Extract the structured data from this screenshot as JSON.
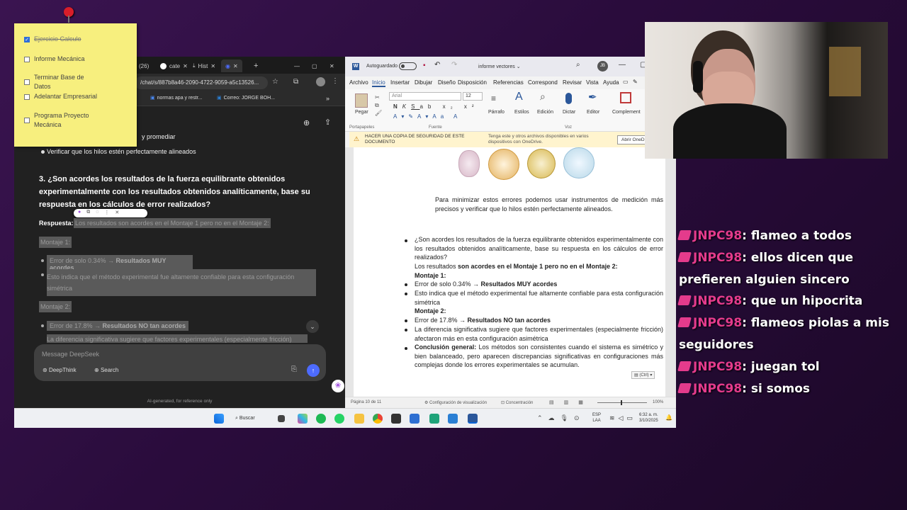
{
  "sticky": {
    "items": [
      {
        "label": "Ejercicio Calculo",
        "checked": true
      },
      {
        "label": "Informe Mecánica",
        "checked": false
      },
      {
        "label": "Terminar Base de Datos",
        "checked": false
      },
      {
        "label": "Adelantar Empresarial",
        "checked": false
      },
      {
        "label": "Programa Proyecto Mecánica",
        "checked": false
      }
    ]
  },
  "chrome": {
    "tabs": [
      {
        "label": "(26)"
      },
      {
        "label": "cate"
      },
      {
        "label": "Hist"
      }
    ],
    "url": "/chat/s/887b8a46-2090-4722-9059-a5c13526...",
    "bookmarks": [
      {
        "label": "normas apa y restr..."
      },
      {
        "label": "Correo: JORGE BOH..."
      }
    ]
  },
  "deepseek": {
    "partial_line": "y promediar",
    "bullet_prev": "Verificar que los hilos estén perfectamente alineados",
    "question": "3. ¿Son acordes los resultados de la fuerza equilibrante obtenidos experimentalmente con los resultados obtenidos analíticamente, base su respuesta en los cálculos de error realizados?",
    "answer_label": "Respuesta:",
    "answer_text": "Los resultados son acordes en el Montaje 1 pero no en el Montaje 2:",
    "montaje1": "Montaje 1:",
    "m1_b1_a": "Error de solo 0.34% → ",
    "m1_b1_b": "Resultados MUY acordes",
    "m1_b2": "Esto indica que el método experimental fue altamente confiable para esta configuración simétrica",
    "montaje2": "Montaje 2:",
    "m2_b1_a": "Error de 17.8% → ",
    "m2_b1_b": "Resultados NO tan acordes",
    "m2_b2": "La diferencia significativa sugiere que factores experimentales (especialmente fricción)",
    "placeholder": "Message DeepSeek",
    "deepthink": "DeepThink",
    "search": "Search",
    "footer": "AI-generated, for reference only"
  },
  "word": {
    "autosave": "Autoguardado",
    "doc_title": "informe vectores",
    "menu": [
      "Archivo",
      "Inicio",
      "Insertar",
      "Dibujar",
      "Diseño",
      "Disposición",
      "Referencias",
      "Correspond",
      "Revisar",
      "Vista",
      "Ayuda"
    ],
    "font": "Arial",
    "size": "12",
    "ribbon_groups": [
      "Pegar",
      "Portapapeles",
      "Fuente",
      "Párrafo",
      "Estilos",
      "Edición",
      "Dictar",
      "Voz",
      "Editor",
      "Complement"
    ],
    "warning_title": "HACER UNA COPIA DE SEGURIDAD DE ESTE DOCUMENTO",
    "warning_text": "Tenga este y otros archivos disponibles en varios dispositivos con OneDrive.",
    "warning_button": "Abrir OneD",
    "p1": "Para minimizar estos errores podemos usar instrumentos de medición más precisos y verificar que lo hilos estén perfectamente alineados.",
    "q": "¿Son acordes los resultados de la fuerza equilibrante obtenidos experimentalmente con los resultados obtenidos analíticamente, base su respuesta en los cálculos de error realizados?",
    "r1a": "Los resultados ",
    "r1b": "son acordes en el Montaje 1 pero no en el Montaje 2:",
    "m1": "Montaje 1:",
    "b1a": "Error de solo 0.34% → ",
    "b1b": "Resultados MUY acordes",
    "b2": "Esto indica que el método experimental fue altamente confiable para esta configuración simétrica",
    "m2": "Montaje 2:",
    "b3a": "Error de 17.8% → ",
    "b3b": "Resultados NO tan acordes",
    "b4": "La diferencia significativa sugiere que factores experimentales (especialmente fricción) afectaron más en esta configuración asimétrica",
    "concl_label": "Conclusión general:",
    "concl": "Los métodos son consistentes cuando el sistema es simétrico y bien balanceado, pero aparecen discrepancias significativas en configuraciones más complejas donde los errores experimentales se acumulan.",
    "paste_tag": "(Ctrl)",
    "status_page": "Página 10 de 11",
    "status_view": "Configuración de visualización",
    "status_focus": "Concentración",
    "zoom": "100%"
  },
  "taskbar": {
    "search": "Buscar",
    "lang1": "ESP",
    "lang2": "LAA",
    "time": "6:32 a. m.",
    "date": "3/10/2025"
  },
  "chat": [
    {
      "user": "JNPC98",
      "msg": "flameo a todos"
    },
    {
      "user": "JNPC98",
      "msg": "ellos dicen que prefieren alguien sincero"
    },
    {
      "user": "JNPC98",
      "msg": "que un hipocrita"
    },
    {
      "user": "JNPC98",
      "msg": "flameos piolas a mis seguidores"
    },
    {
      "user": "JNPC98",
      "msg": "juegan tol"
    },
    {
      "user": "JNPC98",
      "msg": "si somos"
    }
  ],
  "colors": {
    "accent_word": "#2b579a",
    "chat_user": "#e43b8c",
    "sticky": "#f7ef7e"
  }
}
